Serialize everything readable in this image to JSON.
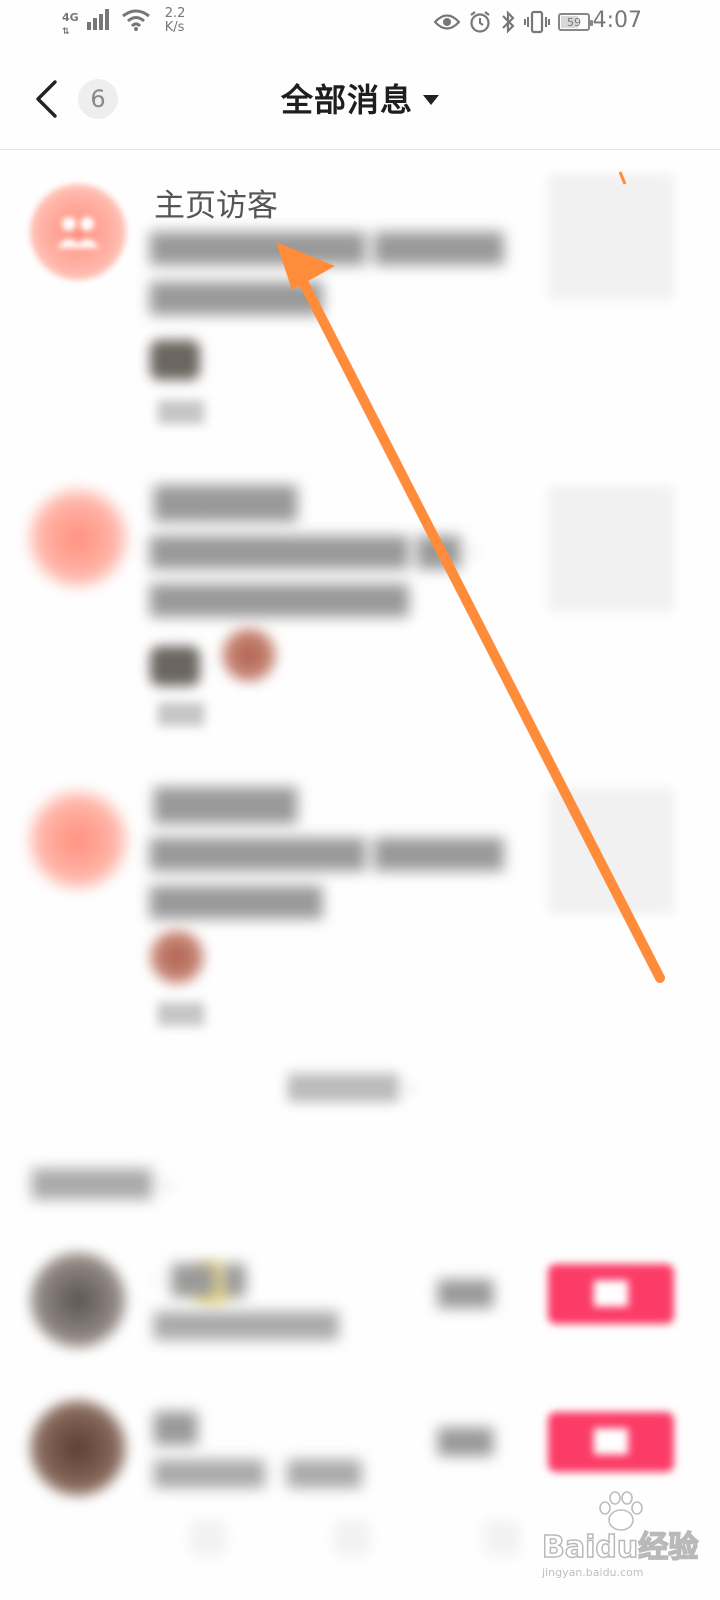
{
  "status_bar": {
    "network": "4G",
    "speed_value": "2.2",
    "speed_unit": "K/s",
    "battery_level": "59",
    "battery_fraction": 0.59,
    "time": "4:07",
    "icons": [
      "signal-icon",
      "wifi-icon",
      "eye-icon",
      "alarm-icon",
      "bluetooth-icon",
      "vibrate-icon",
      "battery-icon"
    ]
  },
  "header": {
    "back_icon": "chevron-left-icon",
    "unread_count": "6",
    "title": "全部消息",
    "dropdown_icon": "caret-down-icon"
  },
  "messages": [
    {
      "title": "主页访客",
      "line1": "██████████ ██████",
      "line2": "████████",
      "time": "███",
      "icon": "visitors-icon"
    },
    {
      "title": "██████",
      "line1": "████████████ ██ ·",
      "line2": "████████████",
      "time": "███",
      "icon": "heart-icon"
    },
    {
      "title": "██████",
      "line1": "██████████ ██████",
      "line2": "████████",
      "time": "███",
      "icon": "heart-icon"
    }
  ],
  "see_more": "██████ ›",
  "suggestions": {
    "section_title": "██████ ›",
    "rows": [
      {
        "name": "· ██ █",
        "sub": "██████████",
        "mid": "███",
        "button": "██"
      },
      {
        "name": "██",
        "sub": "██████ · ████",
        "mid": "███",
        "button": "██"
      }
    ]
  },
  "colors": {
    "accent_arrow": "#ff8c3b",
    "follow_button": "#fb3c67",
    "avatar_pink": "#ff9a8a",
    "title_text": "#1e1e1e"
  },
  "watermark": {
    "logo": "Baidu经验",
    "site": "jingyan.baidu.com"
  }
}
